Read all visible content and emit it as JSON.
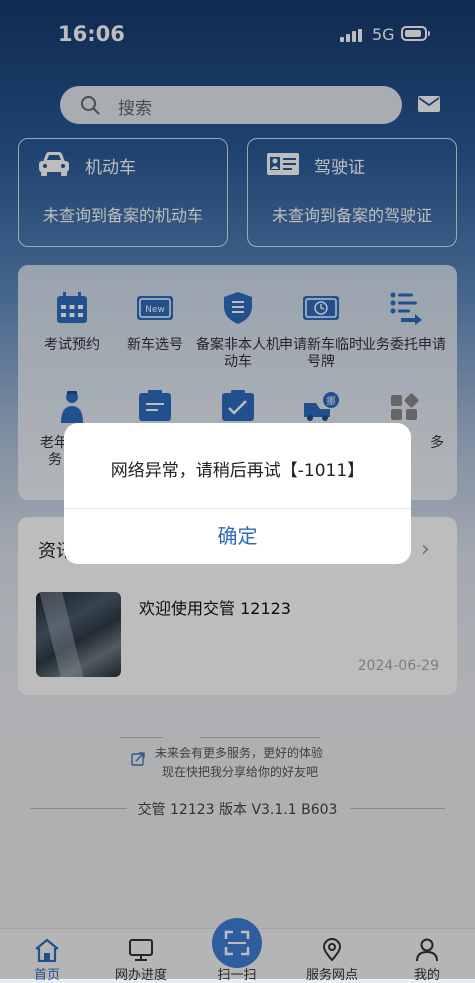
{
  "status_bar": {
    "time": "16:06",
    "network": "5G"
  },
  "search": {
    "placeholder": "搜索"
  },
  "cards": [
    {
      "title": "机动车",
      "subtitle": "未查询到备案的机动车"
    },
    {
      "title": "驾驶证",
      "subtitle": "未查询到备案的驾驶证"
    }
  ],
  "services": [
    {
      "label": "考试预约",
      "icon": "calendar-icon"
    },
    {
      "label": "新车选号",
      "icon": "new-plate-icon"
    },
    {
      "label": "备案非本人机动车",
      "icon": "filing-shield-icon"
    },
    {
      "label": "申请新车临时号牌",
      "icon": "temp-plate-icon"
    },
    {
      "label": "业务委托申请",
      "icon": "delegate-list-icon"
    },
    {
      "label": "老年",
      "label_line2": "务",
      "icon": "elderly-person-icon"
    },
    {
      "icon": "document-icon"
    },
    {
      "icon": "checklist-icon"
    },
    {
      "icon": "tow-truck-icon"
    },
    {
      "label": "多",
      "icon": "more-grid-icon"
    }
  ],
  "news": {
    "section_title": "资讯",
    "item_title": "欢迎使用交管 12123",
    "item_date": "2024-06-29"
  },
  "promo": {
    "line1": "未来会有更多服务，更好的体验",
    "line2": "现在快把我分享给你的好友吧"
  },
  "version": "交管 12123 版本 V3.1.1 B603",
  "tabbar": [
    {
      "label": "首页",
      "icon": "home-icon",
      "active": true
    },
    {
      "label": "网办进度",
      "icon": "monitor-icon"
    },
    {
      "label": "扫一扫",
      "icon": "scan-icon"
    },
    {
      "label": "服务网点",
      "icon": "map-pin-icon"
    },
    {
      "label": "我的",
      "icon": "user-icon"
    }
  ],
  "dialog": {
    "message": "网络异常，请稍后再试【-1011】",
    "confirm": "确定"
  },
  "colors": {
    "accent": "#2e6ab7",
    "header_blue": "#1f4f8c",
    "icon_blue": "#2f6bbf"
  }
}
